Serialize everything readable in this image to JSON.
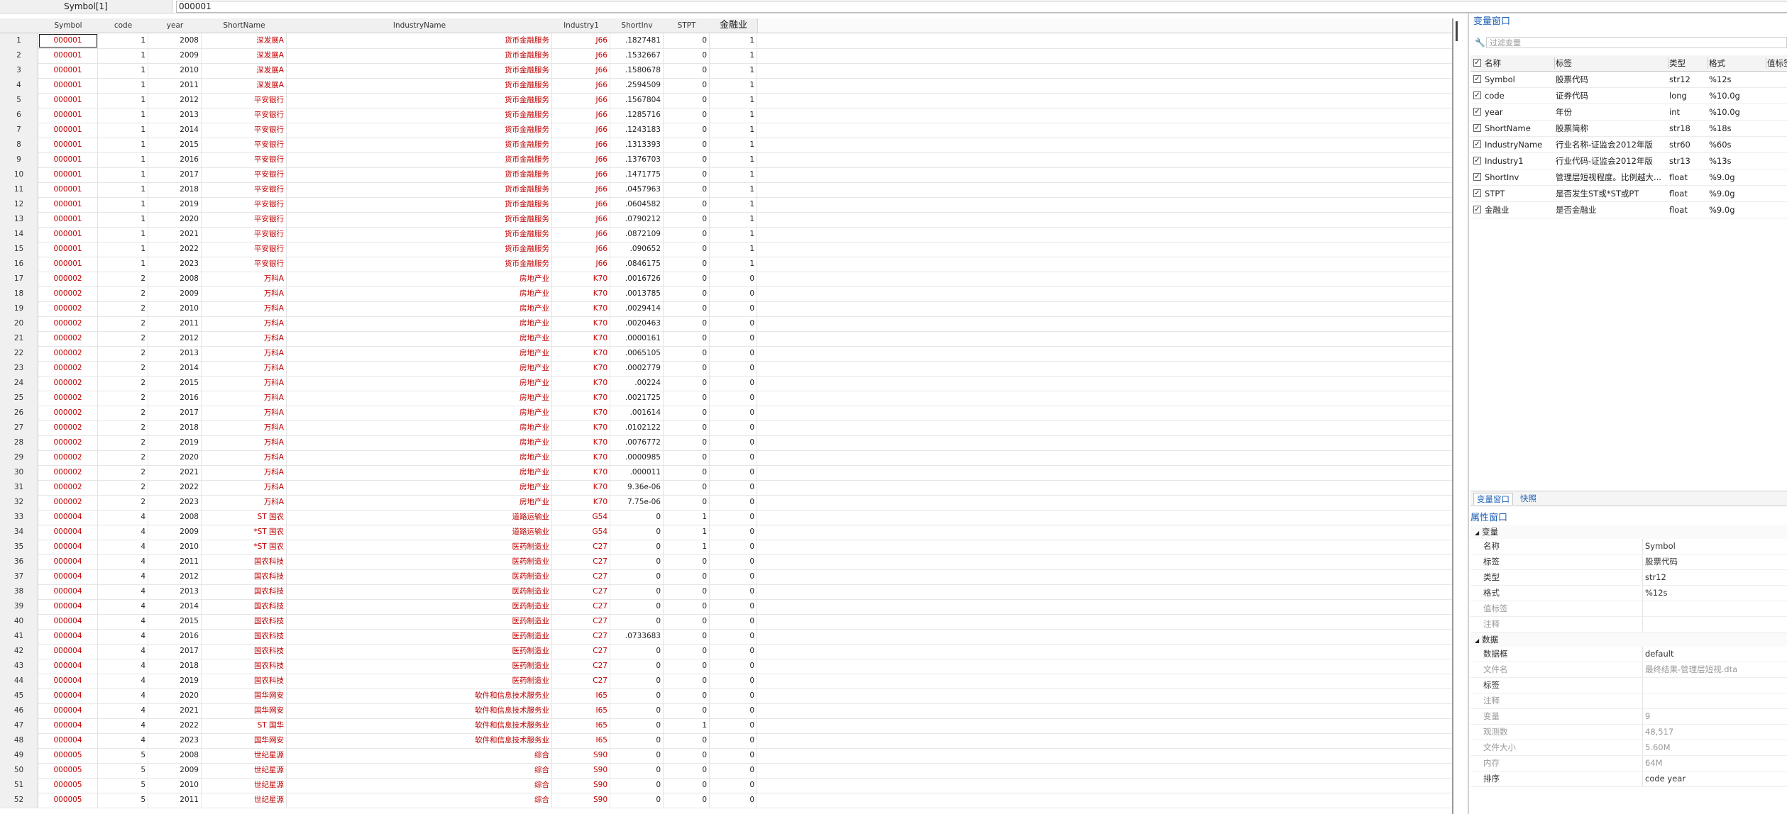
{
  "toolbar": {
    "var_label": "Symbol[1]",
    "value": "000001"
  },
  "columns": [
    "Symbol",
    "code",
    "year",
    "ShortName",
    "IndustryName",
    "Industry1",
    "ShortInv",
    "STPT",
    "金融业"
  ],
  "rows": [
    [
      "1",
      "000001",
      "1",
      "2008",
      "深发展A",
      "货币金融服务",
      "J66",
      ".1827481",
      "0",
      "1"
    ],
    [
      "2",
      "000001",
      "1",
      "2009",
      "深发展A",
      "货币金融服务",
      "J66",
      ".1532667",
      "0",
      "1"
    ],
    [
      "3",
      "000001",
      "1",
      "2010",
      "深发展A",
      "货币金融服务",
      "J66",
      ".1580678",
      "0",
      "1"
    ],
    [
      "4",
      "000001",
      "1",
      "2011",
      "深发展A",
      "货币金融服务",
      "J66",
      ".2594509",
      "0",
      "1"
    ],
    [
      "5",
      "000001",
      "1",
      "2012",
      "平安银行",
      "货币金融服务",
      "J66",
      ".1567804",
      "0",
      "1"
    ],
    [
      "6",
      "000001",
      "1",
      "2013",
      "平安银行",
      "货币金融服务",
      "J66",
      ".1285716",
      "0",
      "1"
    ],
    [
      "7",
      "000001",
      "1",
      "2014",
      "平安银行",
      "货币金融服务",
      "J66",
      ".1243183",
      "0",
      "1"
    ],
    [
      "8",
      "000001",
      "1",
      "2015",
      "平安银行",
      "货币金融服务",
      "J66",
      ".1313393",
      "0",
      "1"
    ],
    [
      "9",
      "000001",
      "1",
      "2016",
      "平安银行",
      "货币金融服务",
      "J66",
      ".1376703",
      "0",
      "1"
    ],
    [
      "10",
      "000001",
      "1",
      "2017",
      "平安银行",
      "货币金融服务",
      "J66",
      ".1471775",
      "0",
      "1"
    ],
    [
      "11",
      "000001",
      "1",
      "2018",
      "平安银行",
      "货币金融服务",
      "J66",
      ".0457963",
      "0",
      "1"
    ],
    [
      "12",
      "000001",
      "1",
      "2019",
      "平安银行",
      "货币金融服务",
      "J66",
      ".0604582",
      "0",
      "1"
    ],
    [
      "13",
      "000001",
      "1",
      "2020",
      "平安银行",
      "货币金融服务",
      "J66",
      ".0790212",
      "0",
      "1"
    ],
    [
      "14",
      "000001",
      "1",
      "2021",
      "平安银行",
      "货币金融服务",
      "J66",
      ".0872109",
      "0",
      "1"
    ],
    [
      "15",
      "000001",
      "1",
      "2022",
      "平安银行",
      "货币金融服务",
      "J66",
      ".090652",
      "0",
      "1"
    ],
    [
      "16",
      "000001",
      "1",
      "2023",
      "平安银行",
      "货币金融服务",
      "J66",
      ".0846175",
      "0",
      "1"
    ],
    [
      "17",
      "000002",
      "2",
      "2008",
      "万科A",
      "房地产业",
      "K70",
      ".0016726",
      "0",
      "0"
    ],
    [
      "18",
      "000002",
      "2",
      "2009",
      "万科A",
      "房地产业",
      "K70",
      ".0013785",
      "0",
      "0"
    ],
    [
      "19",
      "000002",
      "2",
      "2010",
      "万科A",
      "房地产业",
      "K70",
      ".0029414",
      "0",
      "0"
    ],
    [
      "20",
      "000002",
      "2",
      "2011",
      "万科A",
      "房地产业",
      "K70",
      ".0020463",
      "0",
      "0"
    ],
    [
      "21",
      "000002",
      "2",
      "2012",
      "万科A",
      "房地产业",
      "K70",
      ".0000161",
      "0",
      "0"
    ],
    [
      "22",
      "000002",
      "2",
      "2013",
      "万科A",
      "房地产业",
      "K70",
      ".0065105",
      "0",
      "0"
    ],
    [
      "23",
      "000002",
      "2",
      "2014",
      "万科A",
      "房地产业",
      "K70",
      ".0002779",
      "0",
      "0"
    ],
    [
      "24",
      "000002",
      "2",
      "2015",
      "万科A",
      "房地产业",
      "K70",
      ".00224",
      "0",
      "0"
    ],
    [
      "25",
      "000002",
      "2",
      "2016",
      "万科A",
      "房地产业",
      "K70",
      ".0021725",
      "0",
      "0"
    ],
    [
      "26",
      "000002",
      "2",
      "2017",
      "万科A",
      "房地产业",
      "K70",
      ".001614",
      "0",
      "0"
    ],
    [
      "27",
      "000002",
      "2",
      "2018",
      "万科A",
      "房地产业",
      "K70",
      ".0102122",
      "0",
      "0"
    ],
    [
      "28",
      "000002",
      "2",
      "2019",
      "万科A",
      "房地产业",
      "K70",
      ".0076772",
      "0",
      "0"
    ],
    [
      "29",
      "000002",
      "2",
      "2020",
      "万科A",
      "房地产业",
      "K70",
      ".0000985",
      "0",
      "0"
    ],
    [
      "30",
      "000002",
      "2",
      "2021",
      "万科A",
      "房地产业",
      "K70",
      ".000011",
      "0",
      "0"
    ],
    [
      "31",
      "000002",
      "2",
      "2022",
      "万科A",
      "房地产业",
      "K70",
      "9.36e-06",
      "0",
      "0"
    ],
    [
      "32",
      "000002",
      "2",
      "2023",
      "万科A",
      "房地产业",
      "K70",
      "7.75e-06",
      "0",
      "0"
    ],
    [
      "33",
      "000004",
      "4",
      "2008",
      "ST 国农",
      "道路运输业",
      "G54",
      "0",
      "1",
      "0"
    ],
    [
      "34",
      "000004",
      "4",
      "2009",
      "*ST 国农",
      "道路运输业",
      "G54",
      "0",
      "1",
      "0"
    ],
    [
      "35",
      "000004",
      "4",
      "2010",
      "*ST 国农",
      "医药制造业",
      "C27",
      "0",
      "1",
      "0"
    ],
    [
      "36",
      "000004",
      "4",
      "2011",
      "国农科技",
      "医药制造业",
      "C27",
      "0",
      "0",
      "0"
    ],
    [
      "37",
      "000004",
      "4",
      "2012",
      "国农科技",
      "医药制造业",
      "C27",
      "0",
      "0",
      "0"
    ],
    [
      "38",
      "000004",
      "4",
      "2013",
      "国农科技",
      "医药制造业",
      "C27",
      "0",
      "0",
      "0"
    ],
    [
      "39",
      "000004",
      "4",
      "2014",
      "国农科技",
      "医药制造业",
      "C27",
      "0",
      "0",
      "0"
    ],
    [
      "40",
      "000004",
      "4",
      "2015",
      "国农科技",
      "医药制造业",
      "C27",
      "0",
      "0",
      "0"
    ],
    [
      "41",
      "000004",
      "4",
      "2016",
      "国农科技",
      "医药制造业",
      "C27",
      ".0733683",
      "0",
      "0"
    ],
    [
      "42",
      "000004",
      "4",
      "2017",
      "国农科技",
      "医药制造业",
      "C27",
      "0",
      "0",
      "0"
    ],
    [
      "43",
      "000004",
      "4",
      "2018",
      "国农科技",
      "医药制造业",
      "C27",
      "0",
      "0",
      "0"
    ],
    [
      "44",
      "000004",
      "4",
      "2019",
      "国农科技",
      "医药制造业",
      "C27",
      "0",
      "0",
      "0"
    ],
    [
      "45",
      "000004",
      "4",
      "2020",
      "国华网安",
      "软件和信息技术服务业",
      "I65",
      "0",
      "0",
      "0"
    ],
    [
      "46",
      "000004",
      "4",
      "2021",
      "国华网安",
      "软件和信息技术服务业",
      "I65",
      "0",
      "0",
      "0"
    ],
    [
      "47",
      "000004",
      "4",
      "2022",
      "ST 国华",
      "软件和信息技术服务业",
      "I65",
      "0",
      "1",
      "0"
    ],
    [
      "48",
      "000004",
      "4",
      "2023",
      "国华网安",
      "软件和信息技术服务业",
      "I65",
      "0",
      "0",
      "0"
    ],
    [
      "49",
      "000005",
      "5",
      "2008",
      "世纪星源",
      "综合",
      "S90",
      "0",
      "0",
      "0"
    ],
    [
      "50",
      "000005",
      "5",
      "2009",
      "世纪星源",
      "综合",
      "S90",
      "0",
      "0",
      "0"
    ],
    [
      "51",
      "000005",
      "5",
      "2010",
      "世纪星源",
      "综合",
      "S90",
      "0",
      "0",
      "0"
    ],
    [
      "52",
      "000005",
      "5",
      "2011",
      "世纪星源",
      "综合",
      "S90",
      "0",
      "0",
      "0"
    ]
  ],
  "var_panel": {
    "title": "变量窗口",
    "filter_placeholder": "过滤变量",
    "headers": [
      "名称",
      "标签",
      "类型",
      "格式",
      "值标签"
    ],
    "vars": [
      [
        "Symbol",
        "股票代码",
        "str12",
        "%12s"
      ],
      [
        "code",
        "证券代码",
        "long",
        "%10.0g"
      ],
      [
        "year",
        "年份",
        "int",
        "%10.0g"
      ],
      [
        "ShortName",
        "股票简称",
        "str18",
        "%18s"
      ],
      [
        "IndustryName",
        "行业名称-证监会2012年版",
        "str60",
        "%60s"
      ],
      [
        "Industry1",
        "行业代码-证监会2012年版",
        "str13",
        "%13s"
      ],
      [
        "ShortInv",
        "管理层短视程度。比例越大...",
        "float",
        "%9.0g"
      ],
      [
        "STPT",
        "是否发生ST或*ST或PT",
        "float",
        "%9.0g"
      ],
      [
        "金融业",
        "是否金融业",
        "float",
        "%9.0g"
      ]
    ]
  },
  "tabs": [
    "变量窗口",
    "快照"
  ],
  "props": {
    "title": "属性窗口",
    "sec_var": "变量",
    "var_rows": [
      [
        "名称",
        "Symbol",
        false
      ],
      [
        "标签",
        "股票代码",
        false
      ],
      [
        "类型",
        "str12",
        false
      ],
      [
        "格式",
        "%12s",
        false
      ],
      [
        "值标签",
        "",
        true
      ],
      [
        "注释",
        "",
        true
      ]
    ],
    "sec_data": "数据",
    "data_rows": [
      [
        "数据框",
        "default",
        false
      ],
      [
        "文件名",
        "最终结果-管理层短视.dta",
        true
      ],
      [
        "标签",
        "",
        false
      ],
      [
        "注释",
        "",
        true
      ],
      [
        "变量",
        "9",
        true
      ],
      [
        "观测数",
        "48,517",
        true
      ],
      [
        "文件大小",
        "5.60M",
        true
      ],
      [
        "内存",
        "64M",
        true
      ],
      [
        "排序",
        "code year",
        false
      ]
    ]
  }
}
